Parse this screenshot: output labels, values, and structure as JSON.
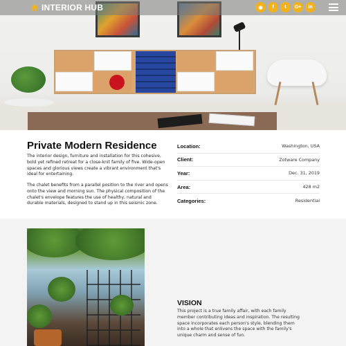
{
  "nav": {
    "brand": "INTERIOR HUB",
    "home_icon": "home-icon",
    "menu_icon": "hamburger-menu-icon",
    "accent": "#f2b21c",
    "socials": [
      {
        "icon": "rss-icon",
        "glyph": "◉"
      },
      {
        "icon": "facebook-icon",
        "glyph": "f"
      },
      {
        "icon": "twitter-icon",
        "glyph": "t"
      },
      {
        "icon": "google-plus-icon",
        "glyph": "G+"
      },
      {
        "icon": "linkedin-icon",
        "glyph": "in"
      }
    ]
  },
  "project": {
    "title": "Private Modern Residence",
    "paragraph1": "The interior design, furniture and installation for this cohesive, bold yet refined retreat for a close-knit family of five. Wide-open spaces and glorious views create a vibrant environment that's ideal for entertaining.",
    "paragraph2": "The chalet benefits from a parallel position to the river and opens onto the view and morning sun. The physical composition of the chalet's envelope features the use of healthy, natural and durable materials, designed to stand up in this seismic zone.",
    "details": [
      {
        "label": "Location:",
        "value": "Washington, USA"
      },
      {
        "label": "Client:",
        "value": "Zotware Company"
      },
      {
        "label": "Year:",
        "value": "Dec. 31, 2019"
      },
      {
        "label": "Area:",
        "value": "428 m2"
      },
      {
        "label": "Categories:",
        "value": "Residential"
      }
    ]
  },
  "vision": {
    "title": "VISION",
    "text": "This project is a true family affair, with each family member contributing ideas and inspiration. The resulting space incorporates each person's style, blending them into a whole that enlivens the space with the family's unique charm and sense of fun."
  }
}
